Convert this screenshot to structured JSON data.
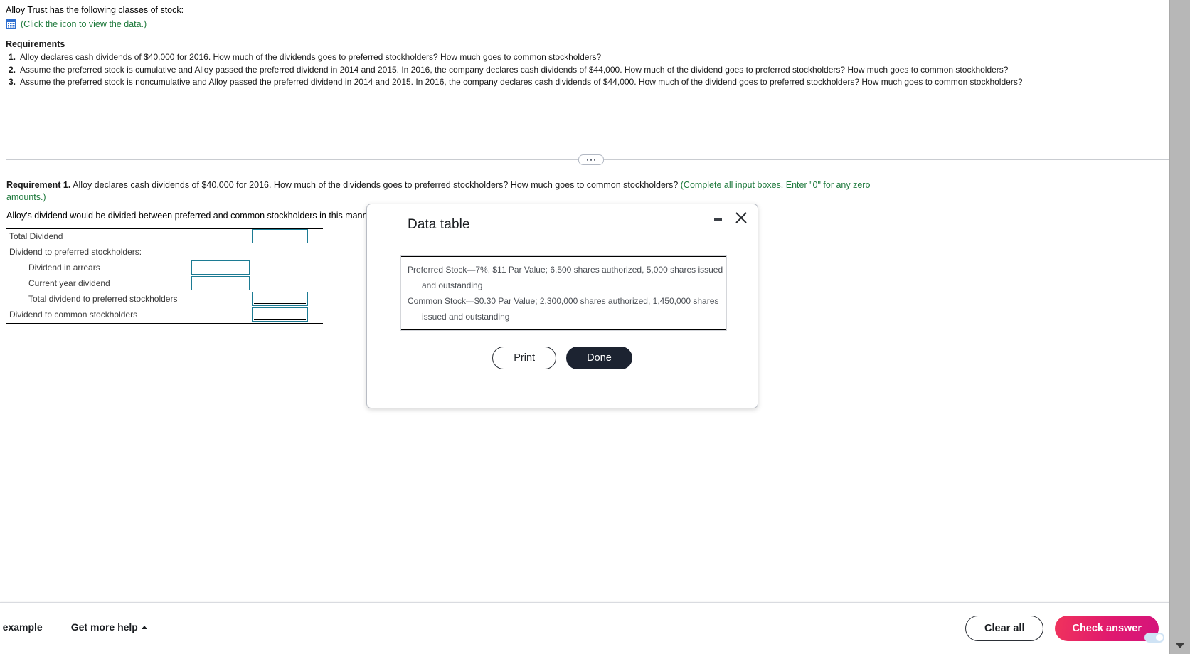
{
  "problem": {
    "intro": "Alloy Trust has the following classes of stock:",
    "data_link": "(Click the icon to view the data.)",
    "data_icon": "table-grid-icon",
    "requirements_heading": "Requirements",
    "requirements": [
      {
        "num": "1.",
        "text": "Alloy declares cash dividends of $40,000 for 2016. How much of the dividends goes to preferred stockholders? How much goes to common stockholders?"
      },
      {
        "num": "2.",
        "text": "Assume the preferred stock is cumulative and Alloy passed the preferred dividend in 2014 and 2015. In 2016, the company declares cash dividends of $44,000. How much of the dividend goes to preferred stockholders? How much goes to common stockholders?"
      },
      {
        "num": "3.",
        "text": "Assume the preferred stock is noncumulative and Alloy passed the preferred dividend in 2014 and 2015. In 2016, the company declares cash dividends of $44,000. How much of the dividend goes to preferred stockholders? How much goes to common stockholders?"
      }
    ]
  },
  "answer": {
    "req_label": "Requirement 1.",
    "req_question": "Alloy declares cash dividends of $40,000 for 2016. How much of the dividends goes to preferred stockholders? How much goes to common stockholders?",
    "req_hint": "(Complete all input boxes. Enter \"0\" for any zero amounts.)",
    "intro": "Alloy's dividend would be divided between preferred and common stockholders in this manner:",
    "rows": [
      {
        "label": "Total Dividend",
        "indent": 0,
        "input": "colB",
        "value": "",
        "underline": false
      },
      {
        "label": "Dividend to preferred stockholders:",
        "indent": 0,
        "input": "none",
        "value": "",
        "underline": false
      },
      {
        "label": "Dividend in arrears",
        "indent": 1,
        "input": "colA",
        "value": "",
        "underline": false
      },
      {
        "label": "Current year dividend",
        "indent": 1,
        "input": "colA",
        "value": "",
        "underline": true
      },
      {
        "label": "Total dividend to preferred stockholders",
        "indent": 1,
        "input": "colB",
        "value": "",
        "underline": true
      },
      {
        "label": "Dividend to common stockholders",
        "indent": 0,
        "input": "colB",
        "value": "",
        "underline": true
      }
    ]
  },
  "modal": {
    "title": "Data table",
    "minimize_icon": "minimize-icon",
    "close_icon": "close-icon",
    "lines": [
      {
        "main": "Preferred Stock—7%, $11 Par Value; 6,500 shares authorized, 5,000 shares issued",
        "cont": "and outstanding"
      },
      {
        "main": "Common Stock—$0.30 Par Value; 2,300,000 shares authorized, 1,450,000 shares",
        "cont": "issued and outstanding"
      }
    ],
    "print_label": "Print",
    "done_label": "Done"
  },
  "bottom_bar": {
    "example_label": "s example",
    "more_help_label": "Get more help",
    "clear_all_label": "Clear all",
    "check_answer_label": "Check answer"
  },
  "colors": {
    "link_green": "#1f7a3d",
    "input_border": "#1c7b93",
    "icon_blue": "#2f6fd0",
    "check_answer": "#e0196f",
    "done_dark": "#1c2331"
  }
}
